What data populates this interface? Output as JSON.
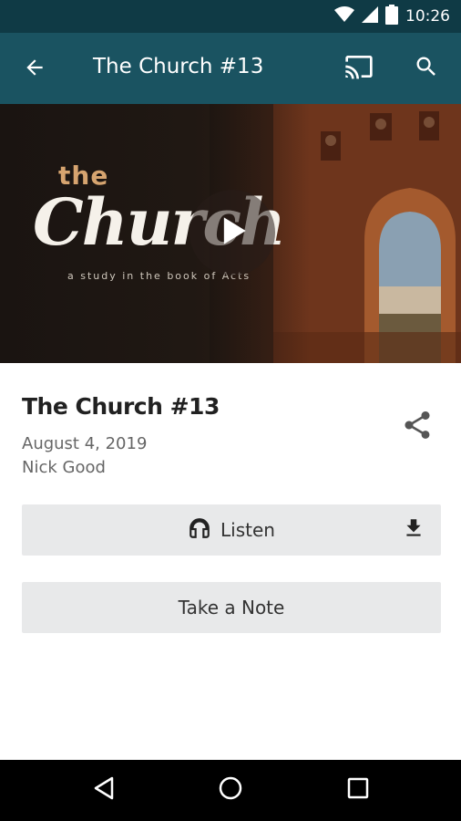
{
  "status_bar": {
    "time": "10:26",
    "icons": [
      "wifi-icon",
      "cell-signal-icon",
      "battery-icon"
    ]
  },
  "app_bar": {
    "title": "The Church #13",
    "background": "#1a5361",
    "icons": [
      "back-arrow-icon",
      "cast-icon",
      "search-icon"
    ]
  },
  "hero": {
    "the": "the",
    "church": "Church",
    "subtitle": "a study in the book of Acts"
  },
  "episode": {
    "title": "The Church #13",
    "date": "August 4, 2019",
    "speaker": "Nick Good"
  },
  "actions": {
    "listen_label": "Listen",
    "note_label": "Take a Note"
  },
  "colors": {
    "status_bar": "#0f3a45",
    "app_bar": "#1a5361",
    "button_bg": "#e8e9ea",
    "hero_accent": "#d6a46f"
  }
}
